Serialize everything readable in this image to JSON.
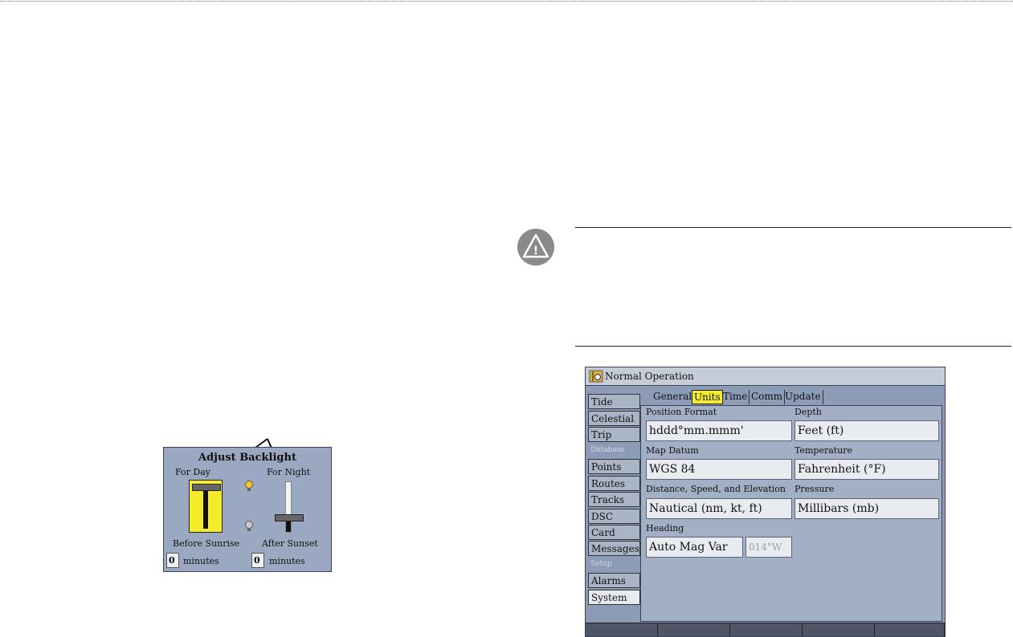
{
  "backlight": {
    "title": "Adjust Backlight",
    "for_day_label": "For Day",
    "for_night_label": "For Night",
    "before_sunrise_label": "Before Sunrise",
    "after_sunset_label": "After Sunset",
    "before_sunrise_value": "0",
    "after_sunset_value": "0",
    "minutes_label": "minutes",
    "colors": {
      "panel": "#9aa8c1",
      "day_slider": "#f4ec2b"
    }
  },
  "caution": {
    "icon": "caution-icon",
    "glyph": "!"
  },
  "screen": {
    "title": "Normal Operation",
    "title_icon": "compass-icon",
    "sidebar_items": [
      {
        "label": "Tide",
        "selected": false
      },
      {
        "label": "Celestial",
        "selected": false
      },
      {
        "label": "Trip",
        "selected": false
      },
      {
        "label": "Points",
        "selected": false
      },
      {
        "label": "Routes",
        "selected": false
      },
      {
        "label": "Tracks",
        "selected": false
      },
      {
        "label": "DSC",
        "selected": false
      },
      {
        "label": "Card",
        "selected": false
      },
      {
        "label": "Messages",
        "selected": false
      },
      {
        "label": "Alarms",
        "selected": false
      },
      {
        "label": "System",
        "selected": true
      }
    ],
    "sidebar_headers": [
      "Database",
      "Setup"
    ],
    "tabs": [
      {
        "label": "General",
        "active": false
      },
      {
        "label": "Units",
        "active": true
      },
      {
        "label": "Time",
        "active": false
      },
      {
        "label": "Comm",
        "active": false
      },
      {
        "label": "Update",
        "active": false
      }
    ],
    "fields": {
      "position_format": {
        "label": "Position Format",
        "value": "hddd°mm.mmm'"
      },
      "depth": {
        "label": "Depth",
        "value": "Feet (ft)"
      },
      "map_datum": {
        "label": "Map Datum",
        "value": "WGS 84"
      },
      "temperature": {
        "label": "Temperature",
        "value": "Fahrenheit (°F)"
      },
      "distance": {
        "label": "Distance, Speed, and Elevation",
        "value": "Nautical (nm, kt, ft)"
      },
      "pressure": {
        "label": "Pressure",
        "value": "Millibars (mb)"
      },
      "heading": {
        "label": "Heading",
        "value": "Auto Mag Var",
        "variation": "014°W"
      }
    },
    "colors": {
      "active_tab": "#f4ec2b",
      "background": "#8d9cb6"
    }
  }
}
